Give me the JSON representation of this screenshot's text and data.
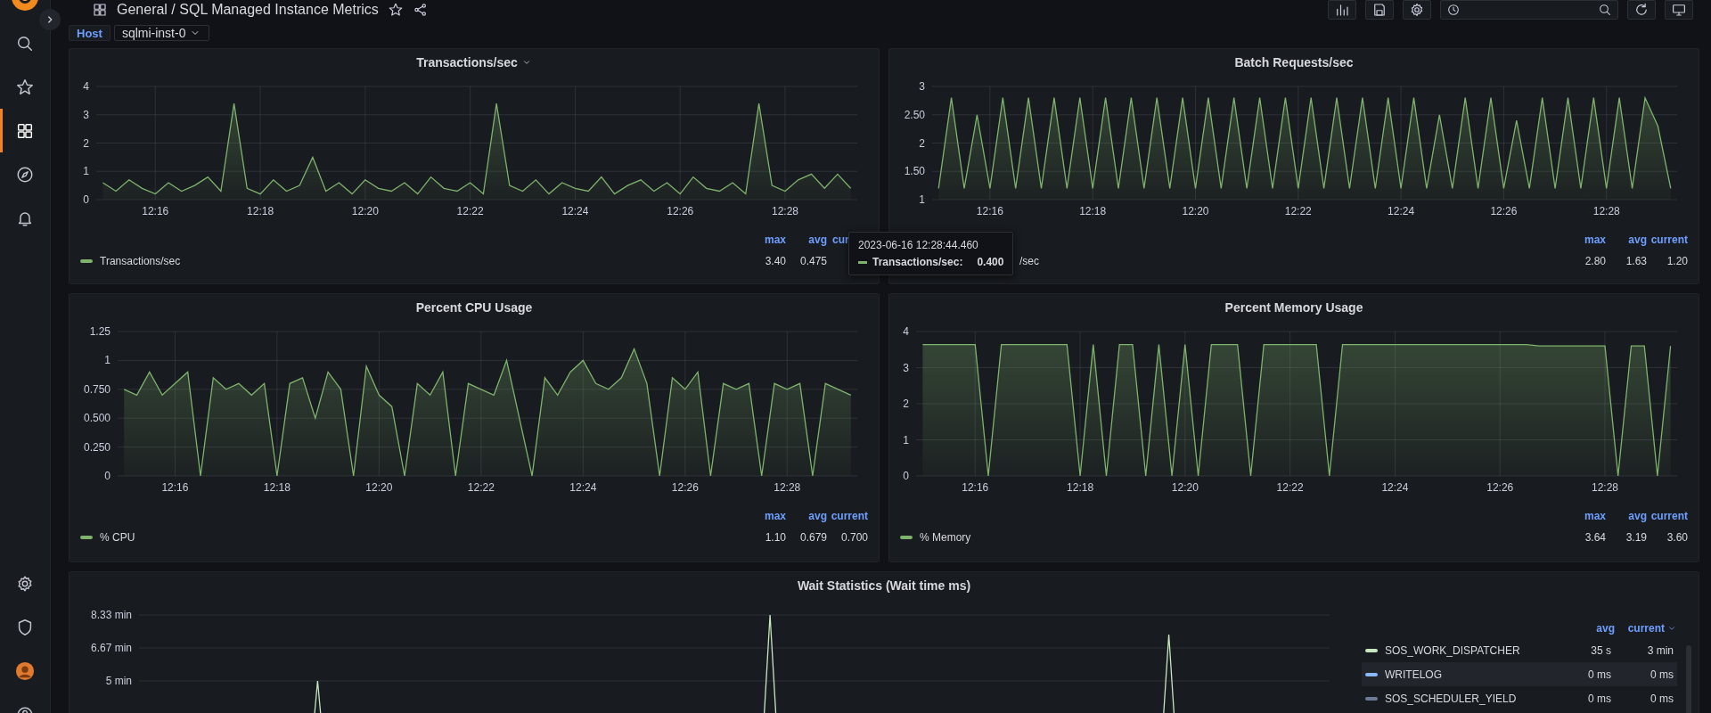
{
  "topbar": {
    "breadcrumb": "General / SQL Managed Instance Metrics",
    "starred": false
  },
  "sidebar": {
    "top": [
      {
        "kind": "search",
        "selected": false
      },
      {
        "kind": "star",
        "selected": false
      },
      {
        "kind": "dashboards",
        "selected": true
      },
      {
        "kind": "explore",
        "selected": false
      },
      {
        "kind": "alerting",
        "selected": false
      }
    ],
    "bottom": [
      {
        "kind": "settings",
        "selected": false
      },
      {
        "kind": "shield",
        "selected": false
      },
      {
        "kind": "avatar",
        "selected": false
      },
      {
        "kind": "help",
        "selected": false
      }
    ]
  },
  "variables": [
    {
      "label": "Host",
      "value": "sqlmi-inst-0"
    }
  ],
  "panels": [
    {
      "title": "Transactions/sec",
      "show_menu": true,
      "chart_data": {
        "type": "area",
        "categories": [
          null,
          null,
          null,
          null,
          "12:16",
          null,
          null,
          null,
          null,
          null,
          null,
          null,
          "12:18",
          null,
          null,
          null,
          null,
          null,
          null,
          null,
          "12:20",
          null,
          null,
          null,
          null,
          null,
          null,
          null,
          "12:22",
          null,
          null,
          null,
          null,
          null,
          null,
          null,
          "12:24",
          null,
          null,
          null,
          null,
          null,
          null,
          null,
          "12:26",
          null,
          null,
          null,
          null,
          null,
          null,
          null,
          "12:28",
          null,
          null,
          null,
          null,
          null
        ],
        "series": [
          {
            "color": "#7eb26d",
            "values": [
              0.6,
              0.3,
              0.7,
              0.4,
              0.2,
              0.6,
              0.3,
              0.5,
              0.8,
              0.3,
              3.4,
              0.4,
              0.2,
              0.7,
              0.3,
              0.5,
              1.5,
              0.3,
              0.6,
              0.2,
              0.7,
              0.4,
              0.3,
              0.6,
              0.2,
              0.8,
              0.4,
              0.3,
              0.6,
              0.2,
              3.4,
              0.5,
              0.3,
              0.7,
              0.2,
              0.6,
              0.4,
              0.3,
              0.8,
              0.2,
              0.5,
              0.7,
              0.3,
              0.6,
              0.2,
              0.8,
              0.4,
              0.3,
              0.6,
              0.2,
              3.4,
              0.5,
              0.3,
              0.7,
              0.9,
              0.4,
              0.9,
              0.4
            ]
          }
        ],
        "ylim": [
          0,
          4
        ],
        "yticks": [
          0,
          1,
          2,
          3,
          4
        ],
        "grid": true
      },
      "legend": {
        "columns": [
          {
            "label": "max",
            "sorted": false
          },
          {
            "label": "avg",
            "sorted": false
          },
          {
            "label": "cur",
            "sorted": false
          }
        ],
        "items": [
          {
            "name": "Transactions/sec",
            "color": "#7eb26d",
            "values": [
              "3.40",
              "0.475"
            ]
          }
        ]
      }
    },
    {
      "title": "Batch Requests/sec",
      "show_menu": false,
      "chart_data": {
        "type": "area",
        "categories": [
          null,
          null,
          null,
          null,
          "12:16",
          null,
          null,
          null,
          null,
          null,
          null,
          null,
          "12:18",
          null,
          null,
          null,
          null,
          null,
          null,
          null,
          "12:20",
          null,
          null,
          null,
          null,
          null,
          null,
          null,
          "12:22",
          null,
          null,
          null,
          null,
          null,
          null,
          null,
          "12:24",
          null,
          null,
          null,
          null,
          null,
          null,
          null,
          "12:26",
          null,
          null,
          null,
          null,
          null,
          null,
          null,
          "12:28",
          null,
          null,
          null,
          null,
          null
        ],
        "series": [
          {
            "color": "#7eb26d",
            "values": [
              1.2,
              2.8,
              1.2,
              2.5,
              1.2,
              2.8,
              1.2,
              2.8,
              1.2,
              2.8,
              1.2,
              2.8,
              1.2,
              2.8,
              1.2,
              2.8,
              1.2,
              2.8,
              1.2,
              2.8,
              1.2,
              2.8,
              1.2,
              2.8,
              1.2,
              2.8,
              1.2,
              2.8,
              1.2,
              2.8,
              1.2,
              2.8,
              1.2,
              2.8,
              1.2,
              2.8,
              1.2,
              2.8,
              1.2,
              2.5,
              1.2,
              2.8,
              1.2,
              2.8,
              1.2,
              2.4,
              1.2,
              2.8,
              1.2,
              2.8,
              1.2,
              2.8,
              1.2,
              2.8,
              1.2,
              2.8,
              2.3,
              1.2
            ]
          }
        ],
        "ylim": [
          1,
          3
        ],
        "yticks": [
          1,
          {
            "value": 1.5,
            "label": "1.50"
          },
          2,
          {
            "value": 2.5,
            "label": "2.50"
          },
          3
        ],
        "grid": true
      },
      "legend": {
        "columns": [
          {
            "label": "max",
            "sorted": false
          },
          {
            "label": "avg",
            "sorted": false
          },
          {
            "label": "current",
            "sorted": false
          }
        ],
        "items": [
          {
            "name": "/sec",
            "values": [
              "2.80",
              "1.63",
              "1.20"
            ]
          }
        ]
      }
    },
    {
      "title": "Percent CPU Usage",
      "show_menu": false,
      "chart_data": {
        "type": "area",
        "categories": [
          null,
          null,
          null,
          null,
          "12:16",
          null,
          null,
          null,
          null,
          null,
          null,
          null,
          "12:18",
          null,
          null,
          null,
          null,
          null,
          null,
          null,
          "12:20",
          null,
          null,
          null,
          null,
          null,
          null,
          null,
          "12:22",
          null,
          null,
          null,
          null,
          null,
          null,
          null,
          "12:24",
          null,
          null,
          null,
          null,
          null,
          null,
          null,
          "12:26",
          null,
          null,
          null,
          null,
          null,
          null,
          null,
          "12:28",
          null,
          null,
          null,
          null,
          null
        ],
        "series": [
          {
            "color": "#7eb26d",
            "values": [
              0.75,
              0.7,
              0.9,
              0.7,
              0.8,
              0.9,
              0,
              0.85,
              0.75,
              0.8,
              0.7,
              0.8,
              0,
              0.8,
              0.85,
              0.5,
              0.9,
              0.75,
              0,
              0.95,
              0.7,
              0.6,
              0,
              0.8,
              0.7,
              0.9,
              0,
              0.8,
              0.75,
              0.7,
              1,
              0.5,
              0,
              0.85,
              0.7,
              0.9,
              1,
              0.8,
              0.75,
              0.85,
              1.1,
              0.8,
              0,
              0.85,
              0.75,
              0.9,
              0,
              0.8,
              0.75,
              0.8,
              0,
              0.8,
              0.75,
              0.8,
              0,
              0.8,
              0.75,
              0.7
            ]
          }
        ],
        "ylim": [
          0,
          1.25
        ],
        "yticks": [
          0,
          {
            "value": 0.25,
            "label": "0.250"
          },
          {
            "value": 0.5,
            "label": "0.500"
          },
          {
            "value": 0.75,
            "label": "0.750"
          },
          1,
          1.25
        ],
        "grid": true
      },
      "legend": {
        "columns": [
          {
            "label": "max",
            "sorted": false
          },
          {
            "label": "avg",
            "sorted": false
          },
          {
            "label": "current",
            "sorted": false
          }
        ],
        "items": [
          {
            "name": "% CPU",
            "color": "#7eb26d",
            "values": [
              "1.10",
              "0.679",
              "0.700"
            ]
          }
        ]
      }
    },
    {
      "title": "Percent Memory Usage",
      "show_menu": false,
      "chart_data": {
        "type": "area",
        "categories": [
          null,
          null,
          null,
          null,
          "12:16",
          null,
          null,
          null,
          null,
          null,
          null,
          null,
          "12:18",
          null,
          null,
          null,
          null,
          null,
          null,
          null,
          "12:20",
          null,
          null,
          null,
          null,
          null,
          null,
          null,
          "12:22",
          null,
          null,
          null,
          null,
          null,
          null,
          null,
          "12:24",
          null,
          null,
          null,
          null,
          null,
          null,
          null,
          "12:26",
          null,
          null,
          null,
          null,
          null,
          null,
          null,
          "12:28",
          null,
          null,
          null,
          null,
          null
        ],
        "series": [
          {
            "color": "#7eb26d",
            "values": [
              3.64,
              3.64,
              3.64,
              3.64,
              3.64,
              0,
              3.64,
              3.64,
              3.64,
              3.64,
              3.64,
              3.64,
              0,
              3.64,
              0,
              3.64,
              3.64,
              0,
              3.64,
              0,
              3.64,
              0,
              3.64,
              3.64,
              3.64,
              0,
              3.64,
              3.64,
              3.64,
              3.64,
              3.64,
              0,
              3.64,
              3.64,
              3.64,
              3.64,
              3.64,
              3.64,
              3.64,
              3.64,
              3.64,
              3.64,
              3.64,
              3.64,
              3.64,
              3.64,
              3.64,
              3.6,
              3.6,
              3.6,
              3.6,
              3.6,
              3.6,
              0,
              3.6,
              3.6,
              0,
              3.6
            ]
          }
        ],
        "ylim": [
          0,
          4
        ],
        "yticks": [
          0,
          1,
          2,
          3,
          4
        ],
        "grid": true
      },
      "legend": {
        "columns": [
          {
            "label": "max",
            "sorted": false
          },
          {
            "label": "avg",
            "sorted": false
          },
          {
            "label": "current",
            "sorted": false
          }
        ],
        "items": [
          {
            "name": "% Memory",
            "color": "#7eb26d",
            "values": [
              "3.64",
              "3.19",
              "3.60"
            ]
          }
        ]
      }
    },
    {
      "title": "Wait Statistics (Wait time ms)",
      "show_menu": false,
      "y_axis_labels": [
        "8.33 min",
        "6.67 min",
        "5 min"
      ],
      "legend": {
        "columns": [
          {
            "label": "avg",
            "sorted": false
          },
          {
            "label": "current",
            "sorted": true
          }
        ],
        "items": [
          {
            "name": "SOS_WORK_DISPATCHER",
            "color": "#c8e6bf",
            "values": [
              "35 s",
              "3 min"
            ],
            "selected": false
          },
          {
            "name": "WRITELOG",
            "color": "#8ab8ff",
            "values": [
              "0 ms",
              "0 ms"
            ],
            "selected": true
          },
          {
            "name": "SOS_SCHEDULER_YIELD",
            "color": "#6d7a94",
            "values": [
              "0 ms",
              "0 ms"
            ],
            "selected": false
          }
        ]
      }
    }
  ],
  "tooltip": {
    "time": "2023-06-16 12:28:44.460",
    "series": [
      {
        "name": "Transactions/sec:",
        "color": "#7eb26d",
        "value": "0.400"
      }
    ]
  }
}
